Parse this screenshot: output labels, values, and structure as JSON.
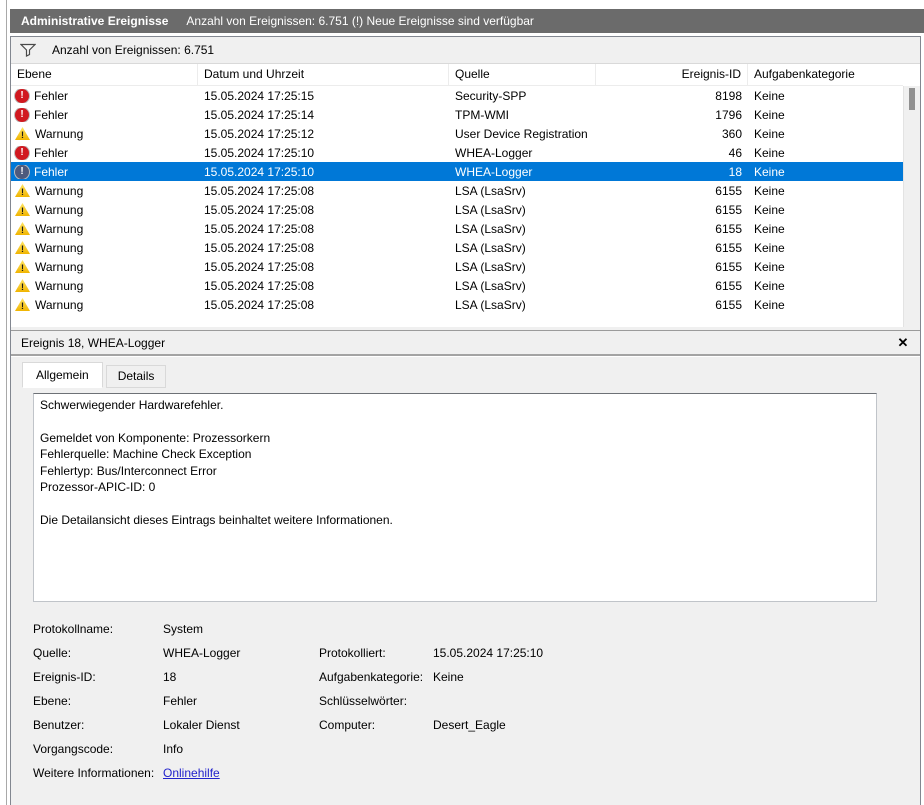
{
  "title_bar": {
    "title": "Administrative Ereignisse",
    "subtitle": "Anzahl von Ereignissen: 6.751 (!) Neue Ereignisse sind verfügbar"
  },
  "filter_bar": {
    "icon": "filter-funnel-icon",
    "label": "Anzahl von Ereignissen: 6.751"
  },
  "table": {
    "columns": [
      "Ebene",
      "Datum und Uhrzeit",
      "Quelle",
      "Ereignis-ID",
      "Aufgabenkategorie"
    ],
    "rows": [
      {
        "icon": "error",
        "level": "Fehler",
        "datetime": "15.05.2024 17:25:15",
        "source": "Security-SPP",
        "event_id": "8198",
        "category": "Keine",
        "selected": false
      },
      {
        "icon": "error",
        "level": "Fehler",
        "datetime": "15.05.2024 17:25:14",
        "source": "TPM-WMI",
        "event_id": "1796",
        "category": "Keine",
        "selected": false
      },
      {
        "icon": "warning",
        "level": "Warnung",
        "datetime": "15.05.2024 17:25:12",
        "source": "User Device Registration",
        "event_id": "360",
        "category": "Keine",
        "selected": false
      },
      {
        "icon": "error",
        "level": "Fehler",
        "datetime": "15.05.2024 17:25:10",
        "source": "WHEA-Logger",
        "event_id": "46",
        "category": "Keine",
        "selected": false
      },
      {
        "icon": "error",
        "level": "Fehler",
        "datetime": "15.05.2024 17:25:10",
        "source": "WHEA-Logger",
        "event_id": "18",
        "category": "Keine",
        "selected": true
      },
      {
        "icon": "warning",
        "level": "Warnung",
        "datetime": "15.05.2024 17:25:08",
        "source": "LSA (LsaSrv)",
        "event_id": "6155",
        "category": "Keine",
        "selected": false
      },
      {
        "icon": "warning",
        "level": "Warnung",
        "datetime": "15.05.2024 17:25:08",
        "source": "LSA (LsaSrv)",
        "event_id": "6155",
        "category": "Keine",
        "selected": false
      },
      {
        "icon": "warning",
        "level": "Warnung",
        "datetime": "15.05.2024 17:25:08",
        "source": "LSA (LsaSrv)",
        "event_id": "6155",
        "category": "Keine",
        "selected": false
      },
      {
        "icon": "warning",
        "level": "Warnung",
        "datetime": "15.05.2024 17:25:08",
        "source": "LSA (LsaSrv)",
        "event_id": "6155",
        "category": "Keine",
        "selected": false
      },
      {
        "icon": "warning",
        "level": "Warnung",
        "datetime": "15.05.2024 17:25:08",
        "source": "LSA (LsaSrv)",
        "event_id": "6155",
        "category": "Keine",
        "selected": false
      },
      {
        "icon": "warning",
        "level": "Warnung",
        "datetime": "15.05.2024 17:25:08",
        "source": "LSA (LsaSrv)",
        "event_id": "6155",
        "category": "Keine",
        "selected": false
      },
      {
        "icon": "warning",
        "level": "Warnung",
        "datetime": "15.05.2024 17:25:08",
        "source": "LSA (LsaSrv)",
        "event_id": "6155",
        "category": "Keine",
        "selected": false
      }
    ]
  },
  "details": {
    "header": "Ereignis 18, WHEA-Logger",
    "close_glyph": "✕",
    "tabs": [
      {
        "label": "Allgemein",
        "active": true
      },
      {
        "label": "Details",
        "active": false
      }
    ],
    "general_text": "Schwerwiegender Hardwarefehler.\n\nGemeldet von Komponente: Prozessorkern\nFehlerquelle: Machine Check Exception\nFehlertyp: Bus/Interconnect Error\nProzessor-APIC-ID: 0\n\nDie Detailansicht dieses Eintrags beinhaltet weitere Informationen.",
    "fields": [
      {
        "label": "Protokollname:",
        "value": "System",
        "label2": "",
        "value2": ""
      },
      {
        "label": "Quelle:",
        "value": "WHEA-Logger",
        "label2": "Protokolliert:",
        "value2": "15.05.2024 17:25:10"
      },
      {
        "label": "Ereignis-ID:",
        "value": "18",
        "label2": "Aufgabenkategorie:",
        "value2": "Keine"
      },
      {
        "label": "Ebene:",
        "value": "Fehler",
        "label2": "Schlüsselwörter:",
        "value2": ""
      },
      {
        "label": "Benutzer:",
        "value": "Lokaler Dienst",
        "label2": "Computer:",
        "value2": "Desert_Eagle"
      },
      {
        "label": "Vorgangscode:",
        "value": "Info",
        "label2": "",
        "value2": ""
      },
      {
        "label": "Weitere Informationen:",
        "value": "Onlinehilfe",
        "label2": "",
        "value2": "",
        "link": true
      }
    ]
  },
  "colors": {
    "title_bar_bg": "#6b6b6b",
    "selection": "#0078d7",
    "panel_bg": "#f0f0f0",
    "error_red": "#d11920",
    "warning_yellow": "#f0b400",
    "link_blue": "#2222cc"
  }
}
